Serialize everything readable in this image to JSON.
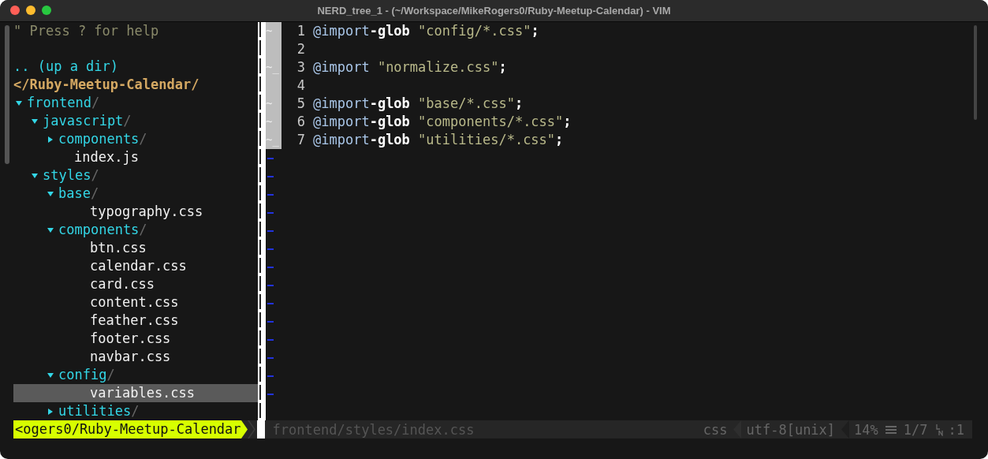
{
  "window": {
    "title": "NERD_tree_1 - (~/Workspace/MikeRogers0/Ruby-Meetup-Calendar) - VIM"
  },
  "tree": {
    "help": "\" Press ? for help",
    "up": ".. (up a dir)",
    "root": "</Ruby-Meetup-Calendar/",
    "items": [
      {
        "kind": "dir",
        "name": "frontend",
        "suffix": "/",
        "expanded": true,
        "selected": false,
        "children": [
          {
            "kind": "dir",
            "name": "javascript",
            "suffix": "/",
            "expanded": true,
            "selected": false,
            "children": [
              {
                "kind": "dir",
                "name": "components",
                "suffix": "/",
                "expanded": false,
                "selected": false
              },
              {
                "kind": "file",
                "name": "index.js",
                "selected": false
              }
            ]
          },
          {
            "kind": "dir",
            "name": "styles",
            "suffix": "/",
            "expanded": true,
            "selected": false,
            "children": [
              {
                "kind": "dir",
                "name": "base",
                "suffix": "/",
                "expanded": true,
                "selected": false,
                "children": [
                  {
                    "kind": "file",
                    "name": "typography.css",
                    "selected": false
                  }
                ]
              },
              {
                "kind": "dir",
                "name": "components",
                "suffix": "/",
                "expanded": true,
                "selected": false,
                "children": [
                  {
                    "kind": "file",
                    "name": "btn.css",
                    "selected": false
                  },
                  {
                    "kind": "file",
                    "name": "calendar.css",
                    "selected": false
                  },
                  {
                    "kind": "file",
                    "name": "card.css",
                    "selected": false
                  },
                  {
                    "kind": "file",
                    "name": "content.css",
                    "selected": false
                  },
                  {
                    "kind": "file",
                    "name": "feather.css",
                    "selected": false
                  },
                  {
                    "kind": "file",
                    "name": "footer.css",
                    "selected": false
                  },
                  {
                    "kind": "file",
                    "name": "navbar.css",
                    "selected": false
                  }
                ]
              },
              {
                "kind": "dir",
                "name": "config",
                "suffix": "/",
                "expanded": true,
                "selected": false,
                "children": [
                  {
                    "kind": "file",
                    "name": "variables.css",
                    "selected": true
                  }
                ]
              },
              {
                "kind": "dir",
                "name": "utilities",
                "suffix": "/",
                "expanded": false,
                "selected": false
              }
            ]
          }
        ]
      }
    ]
  },
  "editor": {
    "lines": [
      {
        "sign": "~",
        "number": "1",
        "tokens": [
          {
            "kind": "keyword",
            "text": "@import"
          },
          {
            "kind": "bold",
            "text": "-glob"
          },
          {
            "kind": "string",
            "text": " \"config/*.css\""
          },
          {
            "kind": "punct",
            "text": ";"
          }
        ]
      },
      {
        "number": "2"
      },
      {
        "sign": "~_",
        "number": "3",
        "tokens": [
          {
            "kind": "keyword",
            "text": "@import"
          },
          {
            "kind": "string",
            "text": " \"normalize.css\""
          },
          {
            "kind": "punct",
            "text": ";"
          }
        ]
      },
      {
        "number": "4"
      },
      {
        "sign": "~",
        "number": "5",
        "tokens": [
          {
            "kind": "keyword",
            "text": "@import"
          },
          {
            "kind": "bold",
            "text": "-glob"
          },
          {
            "kind": "string",
            "text": " \"base/*.css\""
          },
          {
            "kind": "punct",
            "text": ";"
          }
        ]
      },
      {
        "sign": "~",
        "number": "6",
        "tokens": [
          {
            "kind": "keyword",
            "text": "@import"
          },
          {
            "kind": "bold",
            "text": "-glob"
          },
          {
            "kind": "string",
            "text": " \"components/*.css\""
          },
          {
            "kind": "punct",
            "text": ";"
          }
        ]
      },
      {
        "sign": "~_",
        "number": "7",
        "tokens": [
          {
            "kind": "keyword",
            "text": "@import"
          },
          {
            "kind": "bold",
            "text": "-glob"
          },
          {
            "kind": "string",
            "text": " \"utilities/*.css\""
          },
          {
            "kind": "punct",
            "text": ";"
          }
        ]
      }
    ]
  },
  "status_bar": {
    "cwd": "<ogers0/Ruby-Meetup-Calendar",
    "file": "frontend/styles/index.css",
    "filetype": "css",
    "encoding": "utf-8[unix]",
    "percent": "14%",
    "position": "1/7",
    "column": ":1"
  }
}
